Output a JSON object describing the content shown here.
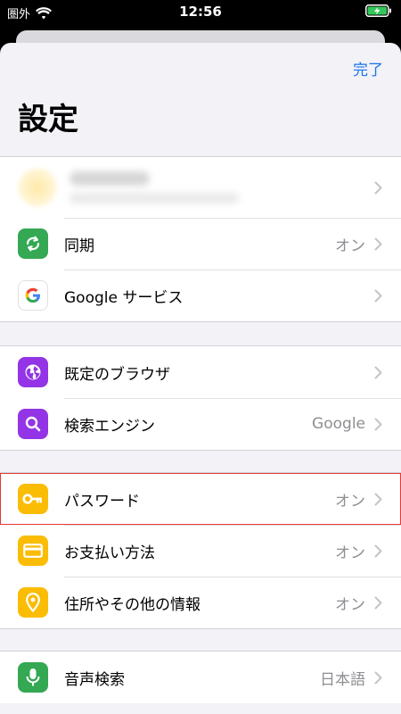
{
  "status_bar": {
    "carrier": "圏外",
    "time": "12:56"
  },
  "sheet": {
    "done_label": "完了",
    "title": "設定"
  },
  "groups": {
    "account_sync": {
      "sync_label": "同期",
      "sync_value": "オン",
      "google_services_label": "Google サービス"
    },
    "browser": {
      "default_browser_label": "既定のブラウザ",
      "search_engine_label": "検索エンジン",
      "search_engine_value": "Google"
    },
    "autofill": {
      "passwords_label": "パスワード",
      "passwords_value": "オン",
      "payment_label": "お支払い方法",
      "payment_value": "オン",
      "address_label": "住所やその他の情報",
      "address_value": "オン"
    },
    "other": {
      "voice_search_label": "音声検索",
      "voice_search_value": "日本語"
    }
  },
  "colors": {
    "sync_icon": "#34a853",
    "browser_icon": "#9334e6",
    "autofill_icon": "#fbbc04",
    "voice_icon": "#34a853",
    "highlight": "#e53935",
    "link": "#1a73e8"
  },
  "icons": {
    "sync": "sync-icon",
    "google": "google-logo-icon",
    "default_browser": "globe-icon",
    "search_engine": "search-icon",
    "passwords": "key-icon",
    "payment": "credit-card-icon",
    "address": "location-pin-icon",
    "voice_search": "microphone-icon"
  }
}
